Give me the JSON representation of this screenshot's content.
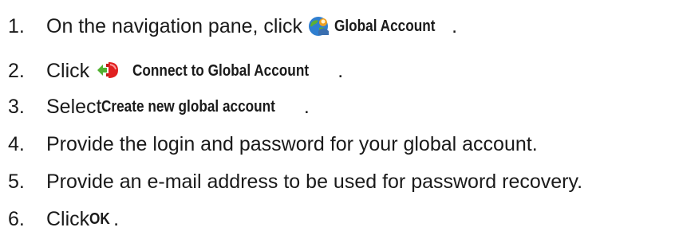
{
  "steps": [
    {
      "number": "1.",
      "prefix": "On the navigation pane, click ",
      "icon": "global-account-icon",
      "ui_label": "Global Account",
      "suffix": "."
    },
    {
      "number": "2.",
      "prefix": "Click ",
      "icon": "connect-to-global-account-icon",
      "ui_label": "Connect to Global Account",
      "suffix": "."
    },
    {
      "number": "3.",
      "prefix": "Select ",
      "ui_label": "Create new global account",
      "suffix": "."
    },
    {
      "number": "4.",
      "text": "Provide the login and password for your global account."
    },
    {
      "number": "5.",
      "text": "Provide an e-mail address to be used for password recovery."
    },
    {
      "number": "6.",
      "prefix": "Click ",
      "ui_label": "OK",
      "suffix": "."
    }
  ],
  "colors": {
    "text": "#1a1a1a",
    "globe_blue": "#2f7fd0",
    "globe_green": "#5cb030",
    "person_orange": "#f0a020",
    "connector_red": "#e02020",
    "connector_green": "#50b030"
  }
}
